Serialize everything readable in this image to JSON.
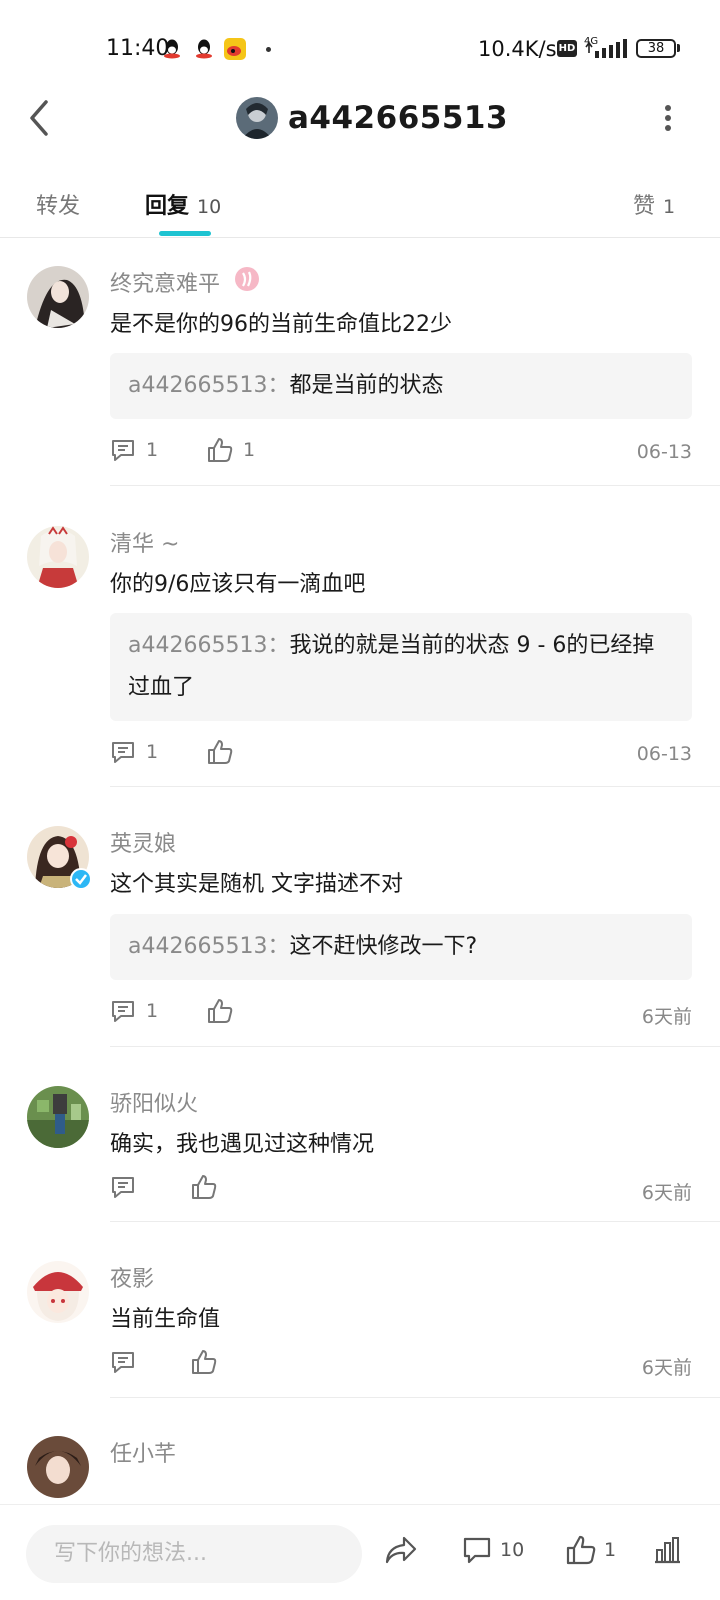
{
  "status_bar": {
    "time": "11:40",
    "speed": "10.4K/s",
    "hd": "HD",
    "network": "4G",
    "battery": "38"
  },
  "header": {
    "title": "a442665513"
  },
  "tabs": [
    {
      "label": "转发",
      "count": ""
    },
    {
      "label": "回复",
      "count": "10"
    },
    {
      "label": "赞",
      "count": "1"
    }
  ],
  "comments": [
    {
      "name": "终究意难平",
      "text": "是不是你的96的当前生命值比22少",
      "reply_user": "a442665513",
      "reply_sep": "：",
      "reply_text": "都是当前的状态",
      "reply_count": "1",
      "like_count": "1",
      "date": "06-13"
    },
    {
      "name": "清华 ~",
      "text": "你的9/6应该只有一滴血吧",
      "reply_user": "a442665513",
      "reply_sep": "：",
      "reply_text": "我说的就是当前的状态 9 - 6的已经掉过血了",
      "reply_count": "1",
      "like_count": "",
      "date": "06-13"
    },
    {
      "name": "英灵娘",
      "text": "这个其实是随机 文字描述不对",
      "reply_user": "a442665513",
      "reply_sep": "：",
      "reply_text": "这不赶快修改一下?",
      "reply_count": "1",
      "like_count": "",
      "date": "6天前"
    },
    {
      "name": "骄阳似火",
      "text": "确实，我也遇见过这种情况",
      "reply_count": "",
      "like_count": "",
      "date": "6天前"
    },
    {
      "name": "夜影",
      "text": "当前生命值",
      "reply_count": "",
      "like_count": "",
      "date": "6天前"
    },
    {
      "name": "任小芊"
    }
  ],
  "bottom_bar": {
    "input_placeholder": "写下你的想法...",
    "comment_count": "10",
    "like_count": "1"
  },
  "colors": {
    "accent": "#1ec3d1",
    "verify_badge": "#2db7f5"
  }
}
